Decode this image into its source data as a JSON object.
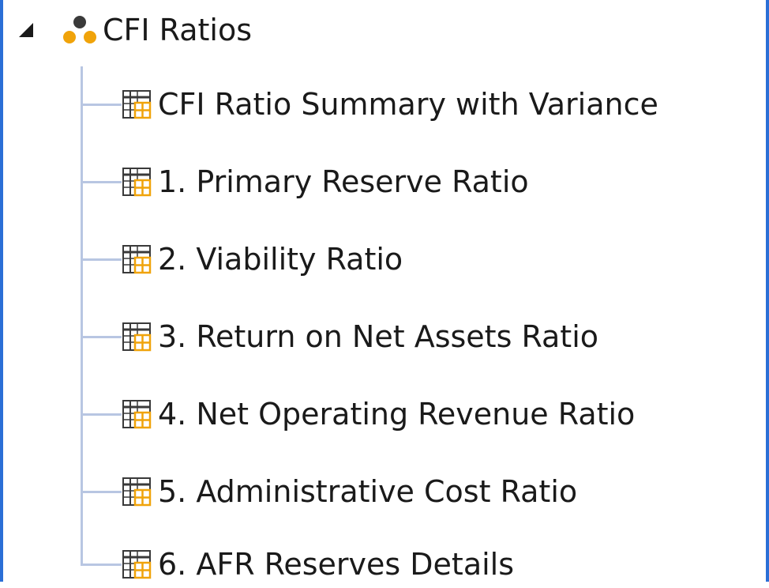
{
  "tree": {
    "root": {
      "label": "CFI Ratios",
      "icon": "group-icon",
      "expanded": true
    },
    "children": [
      {
        "label": "CFI Ratio Summary with Variance",
        "icon": "table-icon"
      },
      {
        "label": "1. Primary Reserve Ratio",
        "icon": "table-icon"
      },
      {
        "label": "2. Viability Ratio",
        "icon": "table-icon"
      },
      {
        "label": "3. Return on Net Assets Ratio",
        "icon": "table-icon"
      },
      {
        "label": "4. Net Operating Revenue Ratio",
        "icon": "table-icon"
      },
      {
        "label": "5. Administrative Cost Ratio",
        "icon": "table-icon"
      },
      {
        "label": "6. AFR Reserves Details",
        "icon": "table-icon"
      }
    ]
  },
  "colors": {
    "frame": "#2b6fd6",
    "guide": "#b8c6e2",
    "icon_orange": "#f0a30a",
    "icon_dark": "#3a3a3a"
  }
}
